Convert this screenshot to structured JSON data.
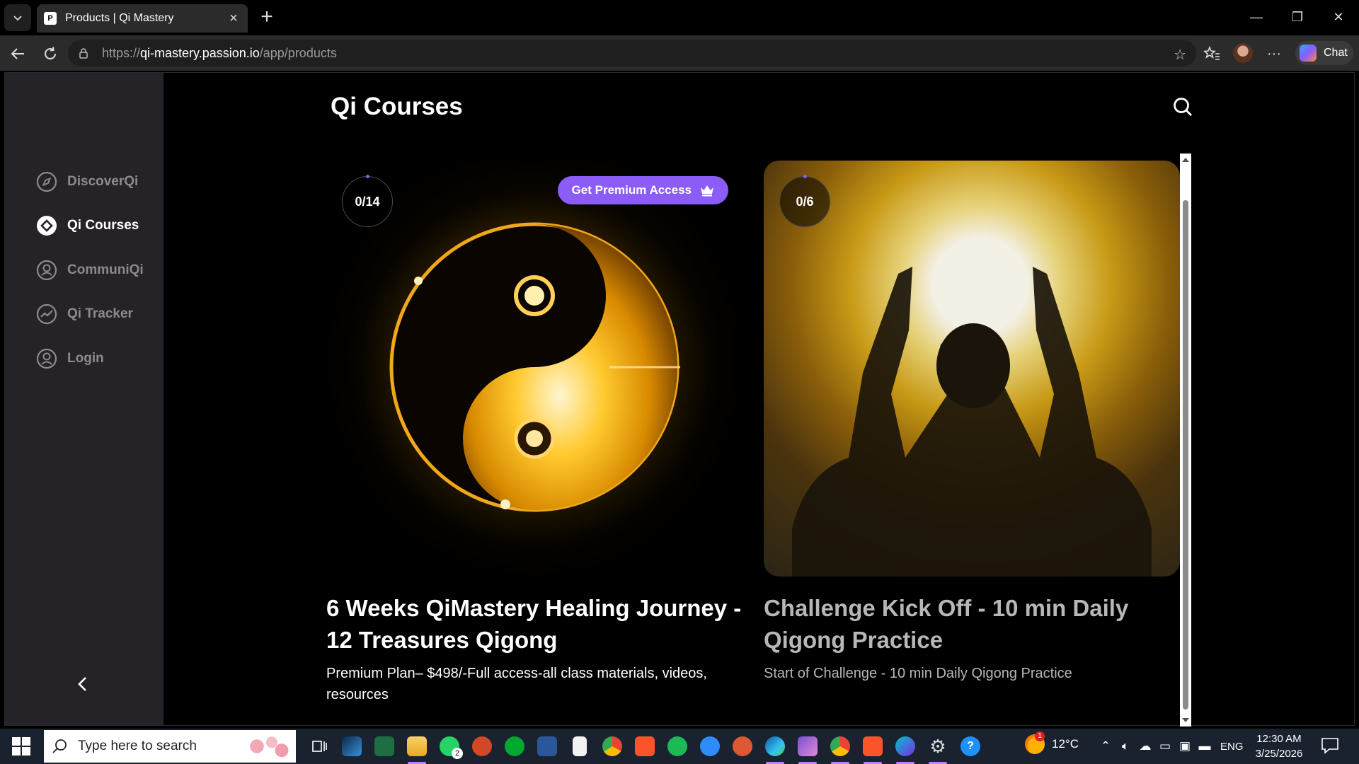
{
  "browser": {
    "tab_title": "Products | Qi Mastery",
    "url_domain": "qi-mastery.passion.io",
    "url_prefix": "https://",
    "url_path": "/app/products",
    "chat_label": "Chat"
  },
  "sidebar": {
    "items": [
      {
        "label": "DiscoverQi",
        "icon": "compass-icon"
      },
      {
        "label": "Qi Courses",
        "icon": "courses-icon",
        "active": true
      },
      {
        "label": "CommuniQi",
        "icon": "community-icon"
      },
      {
        "label": "Qi Tracker",
        "icon": "tracker-icon"
      },
      {
        "label": "Login",
        "icon": "user-icon"
      }
    ]
  },
  "main": {
    "title": "Qi Courses",
    "cards": [
      {
        "progress": "0/14",
        "premium_label": "Get Premium Access",
        "title": "6 Weeks QiMastery Healing Journey - 12 Treasures Qigong",
        "description": "Premium Plan– $498/-Full access-all class materials, videos, resources",
        "image": "golden-yin-yang"
      },
      {
        "progress": "0/6",
        "title": "Challenge Kick Off - 10 min Daily Qigong Practice",
        "description": "Start of Challenge - 10 min Daily Qigong Practice",
        "image": "silhouette-hands-sun"
      }
    ],
    "accent_color": "#8b5cf6"
  },
  "taskbar": {
    "search_placeholder": "Type here to search",
    "temperature": "12°C",
    "language": "ENG",
    "time": "12:30 AM",
    "date": "3/25/2026",
    "whatsapp_badge": "2",
    "weather_badge": "1"
  }
}
